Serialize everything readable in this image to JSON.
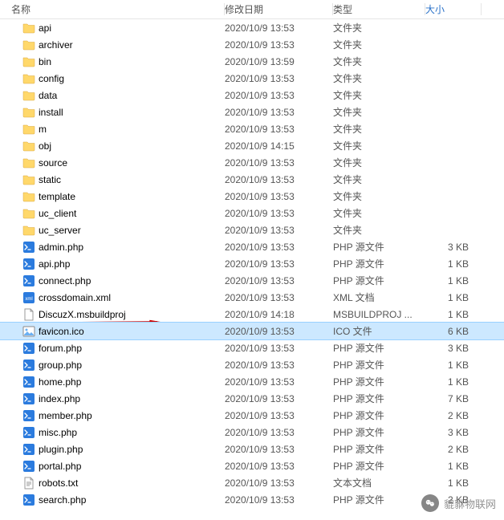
{
  "header": {
    "name": "名称",
    "date": "修改日期",
    "type": "类型",
    "size": "大小"
  },
  "icons": {
    "folder": "folder-icon",
    "php": "php-file-icon",
    "xml": "xml-file-icon",
    "msbuild": "file-icon",
    "ico": "image-file-icon",
    "txt": "text-file-icon"
  },
  "rows": [
    {
      "icon": "folder",
      "name": "api",
      "date": "2020/10/9 13:53",
      "type": "文件夹",
      "size": ""
    },
    {
      "icon": "folder",
      "name": "archiver",
      "date": "2020/10/9 13:53",
      "type": "文件夹",
      "size": ""
    },
    {
      "icon": "folder",
      "name": "bin",
      "date": "2020/10/9 13:59",
      "type": "文件夹",
      "size": ""
    },
    {
      "icon": "folder",
      "name": "config",
      "date": "2020/10/9 13:53",
      "type": "文件夹",
      "size": ""
    },
    {
      "icon": "folder",
      "name": "data",
      "date": "2020/10/9 13:53",
      "type": "文件夹",
      "size": ""
    },
    {
      "icon": "folder",
      "name": "install",
      "date": "2020/10/9 13:53",
      "type": "文件夹",
      "size": ""
    },
    {
      "icon": "folder",
      "name": "m",
      "date": "2020/10/9 13:53",
      "type": "文件夹",
      "size": ""
    },
    {
      "icon": "folder",
      "name": "obj",
      "date": "2020/10/9 14:15",
      "type": "文件夹",
      "size": ""
    },
    {
      "icon": "folder",
      "name": "source",
      "date": "2020/10/9 13:53",
      "type": "文件夹",
      "size": ""
    },
    {
      "icon": "folder",
      "name": "static",
      "date": "2020/10/9 13:53",
      "type": "文件夹",
      "size": ""
    },
    {
      "icon": "folder",
      "name": "template",
      "date": "2020/10/9 13:53",
      "type": "文件夹",
      "size": ""
    },
    {
      "icon": "folder",
      "name": "uc_client",
      "date": "2020/10/9 13:53",
      "type": "文件夹",
      "size": ""
    },
    {
      "icon": "folder",
      "name": "uc_server",
      "date": "2020/10/9 13:53",
      "type": "文件夹",
      "size": ""
    },
    {
      "icon": "php",
      "name": "admin.php",
      "date": "2020/10/9 13:53",
      "type": "PHP 源文件",
      "size": "3 KB"
    },
    {
      "icon": "php",
      "name": "api.php",
      "date": "2020/10/9 13:53",
      "type": "PHP 源文件",
      "size": "1 KB"
    },
    {
      "icon": "php",
      "name": "connect.php",
      "date": "2020/10/9 13:53",
      "type": "PHP 源文件",
      "size": "1 KB"
    },
    {
      "icon": "xml",
      "name": "crossdomain.xml",
      "date": "2020/10/9 13:53",
      "type": "XML 文档",
      "size": "1 KB"
    },
    {
      "icon": "msbuild",
      "name": "DiscuzX.msbuildproj",
      "date": "2020/10/9 14:18",
      "type": "MSBUILDPROJ ...",
      "size": "1 KB",
      "annotated": true
    },
    {
      "icon": "ico",
      "name": "favicon.ico",
      "date": "2020/10/9 13:53",
      "type": "ICO 文件",
      "size": "6 KB",
      "selected": true
    },
    {
      "icon": "php",
      "name": "forum.php",
      "date": "2020/10/9 13:53",
      "type": "PHP 源文件",
      "size": "3 KB"
    },
    {
      "icon": "php",
      "name": "group.php",
      "date": "2020/10/9 13:53",
      "type": "PHP 源文件",
      "size": "1 KB"
    },
    {
      "icon": "php",
      "name": "home.php",
      "date": "2020/10/9 13:53",
      "type": "PHP 源文件",
      "size": "1 KB"
    },
    {
      "icon": "php",
      "name": "index.php",
      "date": "2020/10/9 13:53",
      "type": "PHP 源文件",
      "size": "7 KB"
    },
    {
      "icon": "php",
      "name": "member.php",
      "date": "2020/10/9 13:53",
      "type": "PHP 源文件",
      "size": "2 KB"
    },
    {
      "icon": "php",
      "name": "misc.php",
      "date": "2020/10/9 13:53",
      "type": "PHP 源文件",
      "size": "3 KB"
    },
    {
      "icon": "php",
      "name": "plugin.php",
      "date": "2020/10/9 13:53",
      "type": "PHP 源文件",
      "size": "2 KB"
    },
    {
      "icon": "php",
      "name": "portal.php",
      "date": "2020/10/9 13:53",
      "type": "PHP 源文件",
      "size": "1 KB"
    },
    {
      "icon": "txt",
      "name": "robots.txt",
      "date": "2020/10/9 13:53",
      "type": "文本文档",
      "size": "1 KB"
    },
    {
      "icon": "php",
      "name": "search.php",
      "date": "2020/10/9 13:53",
      "type": "PHP 源文件",
      "size": "2 KB"
    }
  ],
  "watermark": "貔貅物联网"
}
